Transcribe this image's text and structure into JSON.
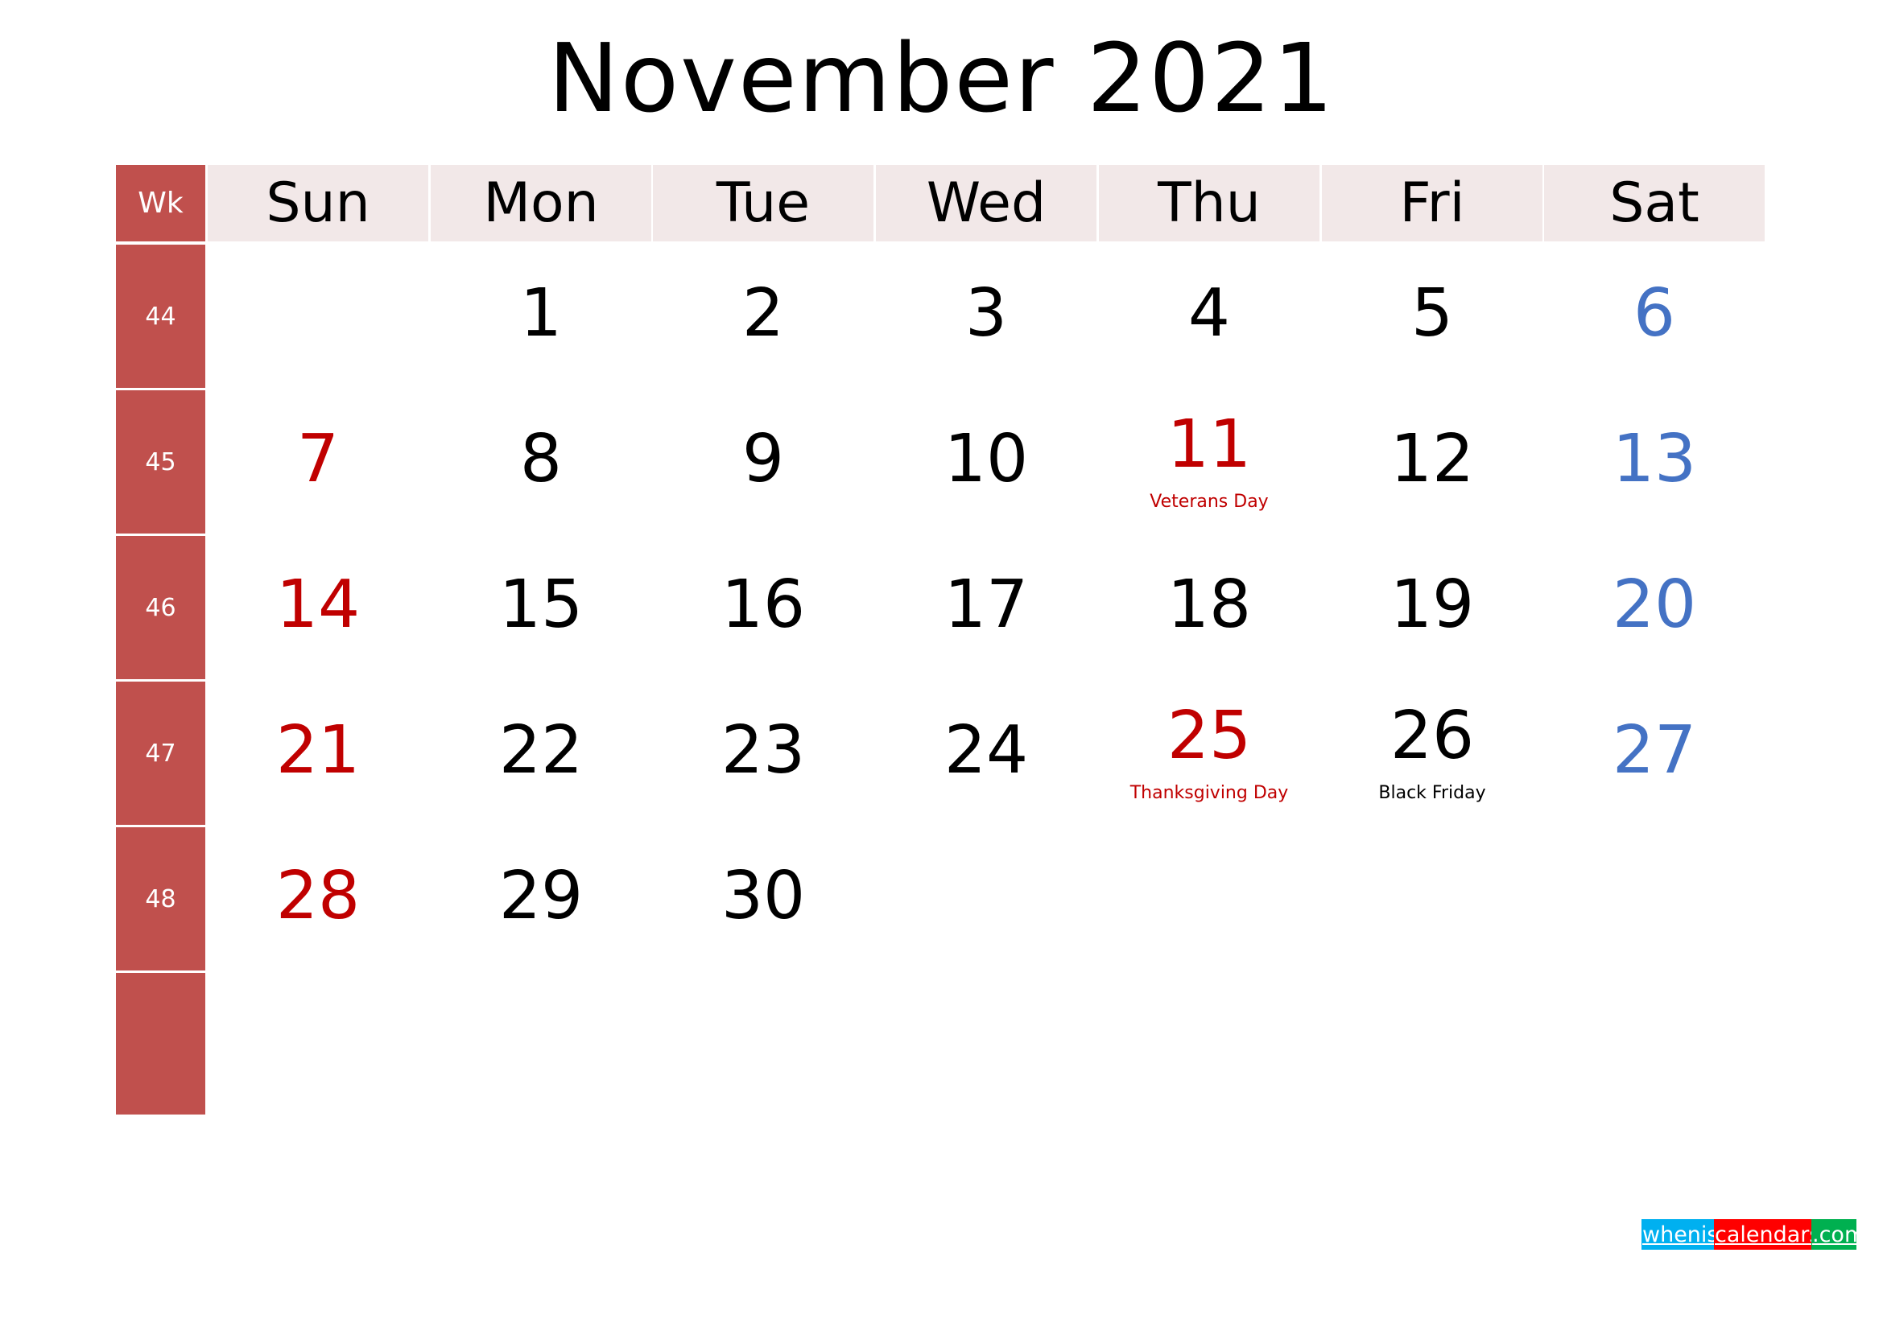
{
  "title": "November 2021",
  "week_header": "Wk",
  "weekdays": [
    "Sun",
    "Mon",
    "Tue",
    "Wed",
    "Thu",
    "Fri",
    "Sat"
  ],
  "colors": {
    "week_column": "#C0504D",
    "header_bg": "#F2E8E8",
    "sunday_holiday": "#C00000",
    "saturday": "#4472C4",
    "weekday": "#000000"
  },
  "weeks": [
    {
      "wk": "44",
      "days": [
        "",
        "1",
        "2",
        "3",
        "4",
        "5",
        "6"
      ]
    },
    {
      "wk": "45",
      "days": [
        "7",
        "8",
        "9",
        "10",
        "11",
        "12",
        "13"
      ]
    },
    {
      "wk": "46",
      "days": [
        "14",
        "15",
        "16",
        "17",
        "18",
        "19",
        "20"
      ]
    },
    {
      "wk": "47",
      "days": [
        "21",
        "22",
        "23",
        "24",
        "25",
        "26",
        "27"
      ]
    },
    {
      "wk": "48",
      "days": [
        "28",
        "29",
        "30",
        "",
        "",
        "",
        ""
      ]
    },
    {
      "wk": "",
      "days": [
        "",
        "",
        "",
        "",
        "",
        "",
        ""
      ]
    }
  ],
  "holidays": [
    {
      "day": "11",
      "name": "Veterans Day",
      "color": "red"
    },
    {
      "day": "25",
      "name": "Thanksgiving Day",
      "color": "red"
    },
    {
      "day": "26",
      "name": "Black Friday",
      "color": "black"
    }
  ],
  "logo": {
    "part1": "whenis",
    "part2": "calendars",
    "part3": ".com"
  }
}
